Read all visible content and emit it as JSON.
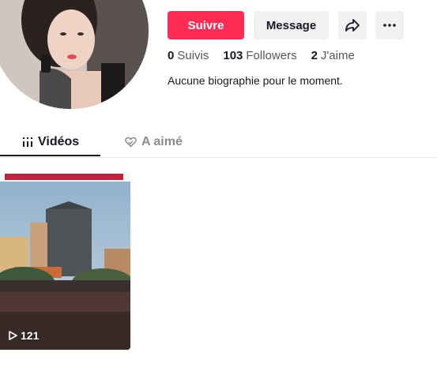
{
  "profile": {
    "follow_label": "Suivre",
    "message_label": "Message",
    "stats": [
      {
        "value": "0",
        "label": "Suivis"
      },
      {
        "value": "103",
        "label": "Followers"
      },
      {
        "value": "2",
        "label": "J'aime"
      }
    ],
    "bio": "Aucune biographie pour le moment."
  },
  "tabs": {
    "videos": "Vidéos",
    "liked": "A aimé"
  },
  "videos": [
    {
      "views": "121"
    }
  ],
  "colors": {
    "accent": "#fe2c55",
    "text": "#161823",
    "muted": "#8a8b91"
  },
  "icons": [
    "share-icon",
    "more-icon",
    "grid-icon",
    "heart-icon",
    "play-icon"
  ]
}
